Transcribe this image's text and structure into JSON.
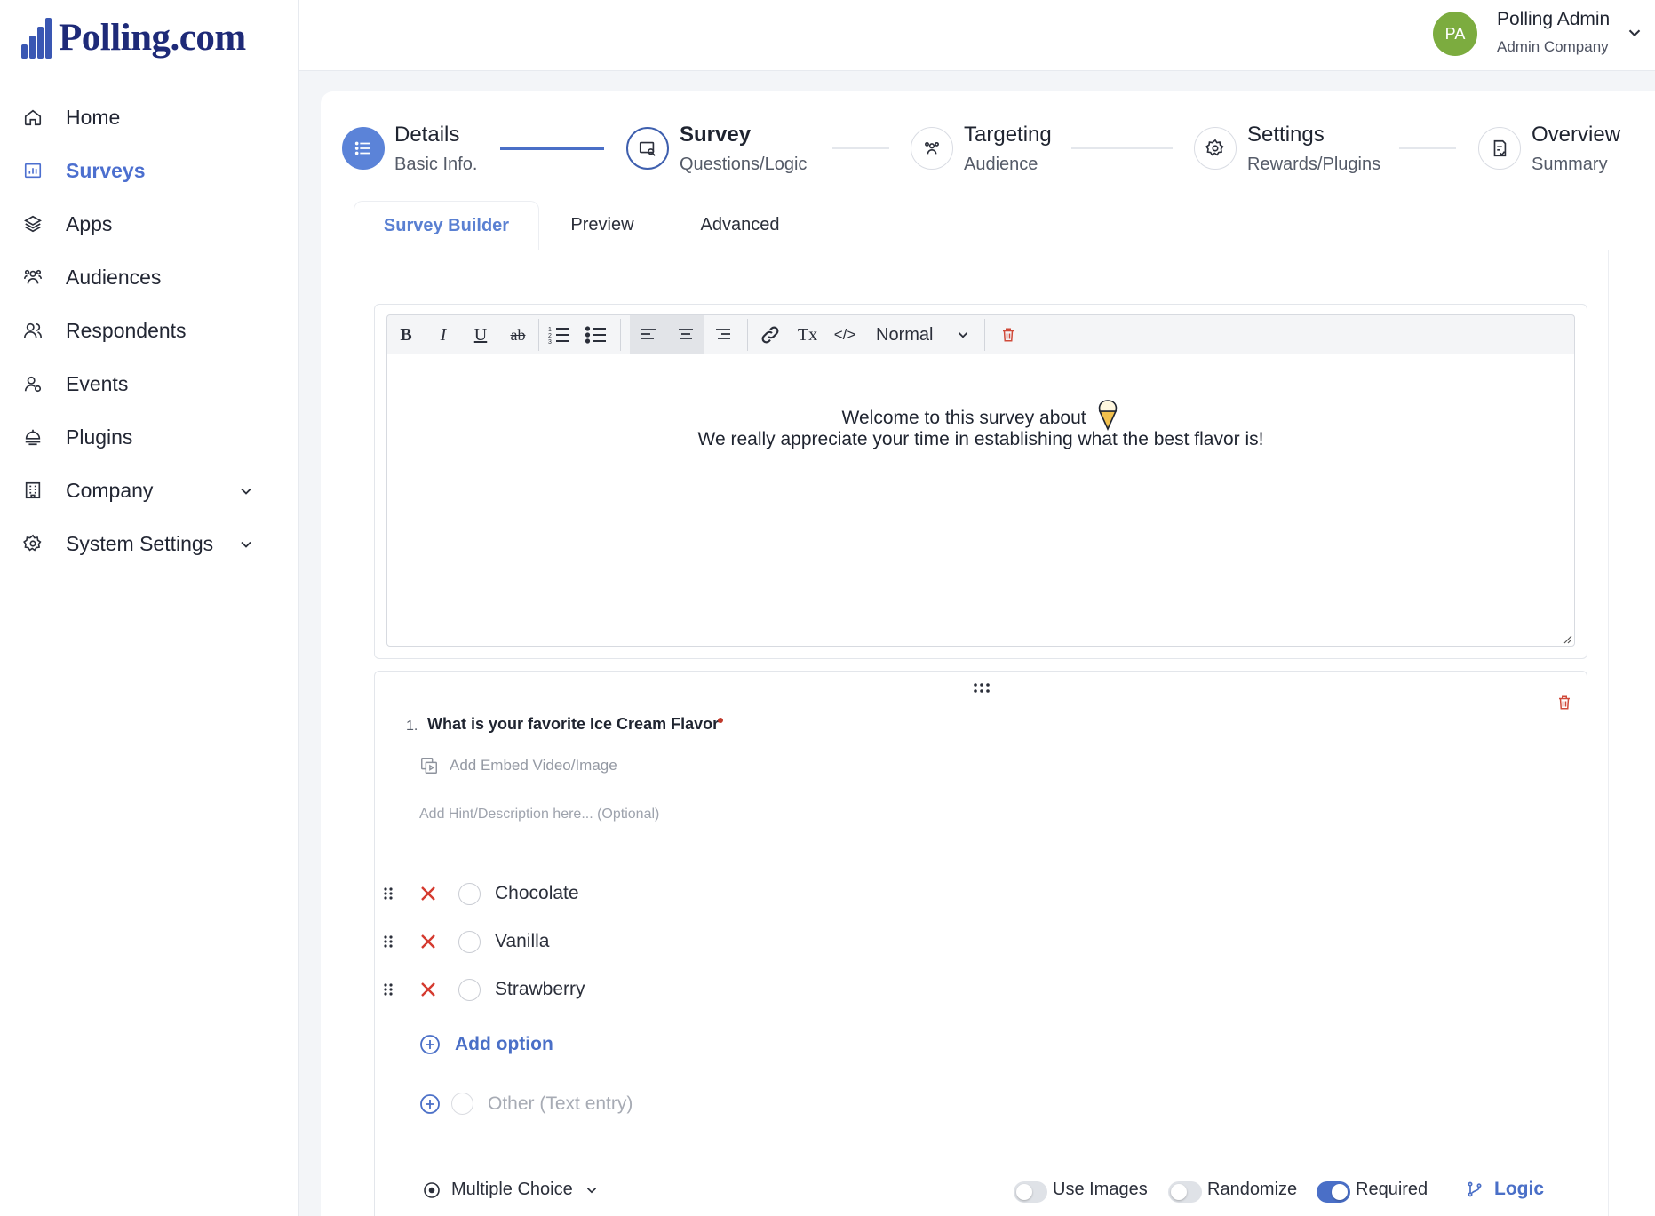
{
  "brand": {
    "name": "Polling.com"
  },
  "sidebar": {
    "items": [
      {
        "label": "Home",
        "icon": "home-icon",
        "active": false
      },
      {
        "label": "Surveys",
        "icon": "bar-chart-icon",
        "active": true
      },
      {
        "label": "Apps",
        "icon": "layers-icon",
        "active": false
      },
      {
        "label": "Audiences",
        "icon": "users-group-icon",
        "active": false
      },
      {
        "label": "Respondents",
        "icon": "users-icon",
        "active": false
      },
      {
        "label": "Events",
        "icon": "user-event-icon",
        "active": false
      },
      {
        "label": "Plugins",
        "icon": "plugin-icon",
        "active": false
      },
      {
        "label": "Company",
        "icon": "building-icon",
        "active": false,
        "expandable": true
      },
      {
        "label": "System Settings",
        "icon": "gear-icon",
        "active": false,
        "expandable": true
      }
    ]
  },
  "user": {
    "initials": "PA",
    "name": "Polling Admin",
    "company": "Admin Company",
    "avatar_color": "#7cac3f"
  },
  "stepper": {
    "steps": [
      {
        "title": "Details",
        "subtitle": "Basic Info.",
        "state": "done"
      },
      {
        "title": "Survey",
        "subtitle": "Questions/Logic",
        "state": "current"
      },
      {
        "title": "Targeting",
        "subtitle": "Audience",
        "state": "pending"
      },
      {
        "title": "Settings",
        "subtitle": "Rewards/Plugins",
        "state": "pending"
      },
      {
        "title": "Overview",
        "subtitle": "Summary",
        "state": "pending"
      }
    ]
  },
  "tabs": [
    {
      "label": "Survey Builder",
      "active": true
    },
    {
      "label": "Preview",
      "active": false
    },
    {
      "label": "Advanced",
      "active": false
    }
  ],
  "editor": {
    "toolbar": {
      "bold": "B",
      "italic": "I",
      "underline": "U",
      "strike": "ab",
      "clear_format": "Tx",
      "code": "</>",
      "format_select": "Normal"
    },
    "content_line1": "Welcome to this survey about",
    "content_line2": "We really appreciate your time in establishing what the best flavor is!"
  },
  "question": {
    "number": "1.",
    "text": "What is your favorite Ice Cream Flavor",
    "required": true,
    "embed_label": "Add Embed Video/Image",
    "hint_placeholder": "Add Hint/Description here... (Optional)",
    "options": [
      "Chocolate",
      "Vanilla",
      "Strawberry"
    ],
    "add_option_label": "Add option",
    "other_option_label": "Other (Text entry)",
    "type_label": "Multiple Choice",
    "toggles": [
      {
        "label": "Use Images",
        "on": false
      },
      {
        "label": "Randomize",
        "on": false
      },
      {
        "label": "Required",
        "on": true
      }
    ],
    "logic_label": "Logic"
  },
  "colors": {
    "accent": "#4a6fc7",
    "brand_navy": "#1e2a78",
    "danger": "#c0392b"
  }
}
